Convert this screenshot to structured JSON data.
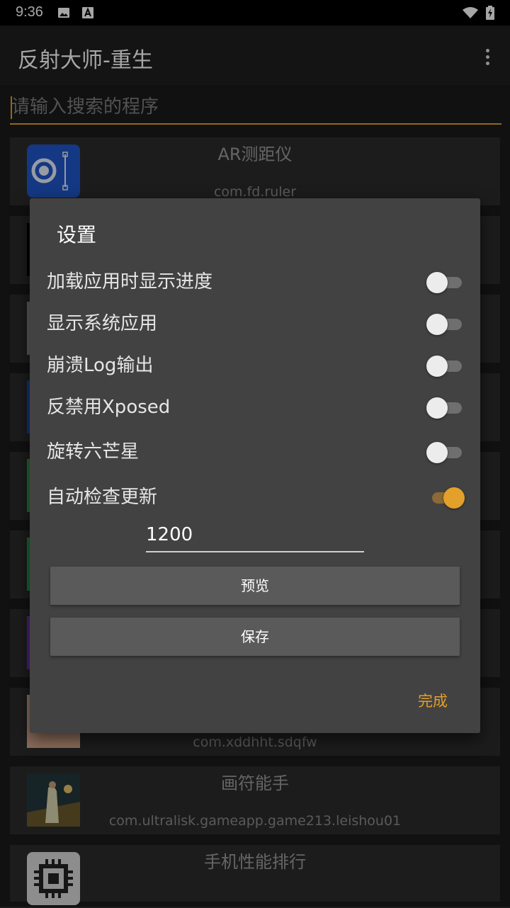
{
  "status_bar": {
    "time": "9:36"
  },
  "app_bar": {
    "title": "反射大师-重生"
  },
  "search": {
    "placeholder": "请输入搜索的程序"
  },
  "apps": [
    {
      "name": "AR测距仪",
      "package": "com.fd.ruler"
    },
    {
      "name": "",
      "package": "com.xddhht.sdqfw"
    },
    {
      "name": "画符能手",
      "package": "com.ultralisk.gameapp.game213.leishou01"
    },
    {
      "name": "手机性能排行",
      "package": ""
    }
  ],
  "dialog": {
    "title": "设置",
    "settings": [
      {
        "label": "加载应用时显示进度",
        "on": false
      },
      {
        "label": "显示系统应用",
        "on": false
      },
      {
        "label": "崩溃Log输出",
        "on": false
      },
      {
        "label": "反禁用Xposed",
        "on": false
      },
      {
        "label": "旋转六芒星",
        "on": false
      },
      {
        "label": "自动检查更新",
        "on": true
      }
    ],
    "interval_value": "1200",
    "preview_button": "预览",
    "save_button": "保存",
    "done_button": "完成"
  },
  "colors": {
    "accent": "#e3a02a",
    "dialog_bg": "#424242",
    "list_item_bg": "#2c2c2c"
  }
}
